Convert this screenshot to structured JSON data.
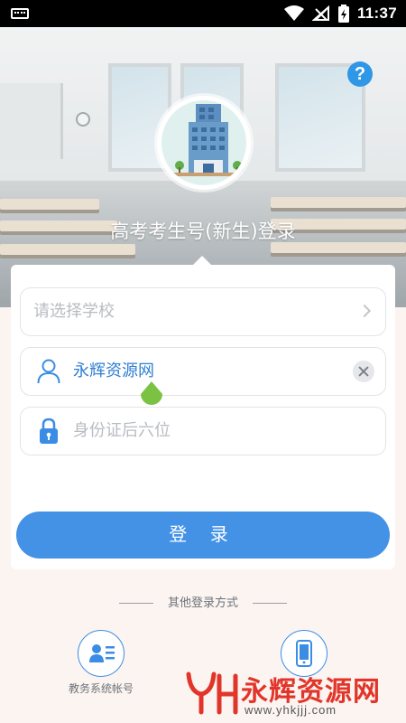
{
  "status_bar": {
    "time": "11:37",
    "icons": [
      "keyboard-icon",
      "wifi-icon",
      "no-sim-icon",
      "battery-charging-icon"
    ]
  },
  "help_label": "?",
  "title": "高考考生号(新生)登录",
  "form": {
    "school": {
      "placeholder": "请选择学校"
    },
    "username": {
      "value": "永辉资源网"
    },
    "password": {
      "placeholder": "身份证后六位"
    }
  },
  "login_button": "登 录",
  "other_login": {
    "heading": "其他登录方式",
    "options": [
      {
        "label": "教务系统帐号",
        "icon": "id-card-icon"
      },
      {
        "label": "",
        "icon": "mobile-phone-icon"
      }
    ]
  },
  "watermark": {
    "brand": "永辉资源网",
    "url": "www.yhkjjj.com"
  },
  "colors": {
    "accent": "#4392e6",
    "help": "#2f97e6",
    "input_text": "#2f7fd1",
    "watermark": "#e2352a",
    "cursor": "#7cc242"
  }
}
